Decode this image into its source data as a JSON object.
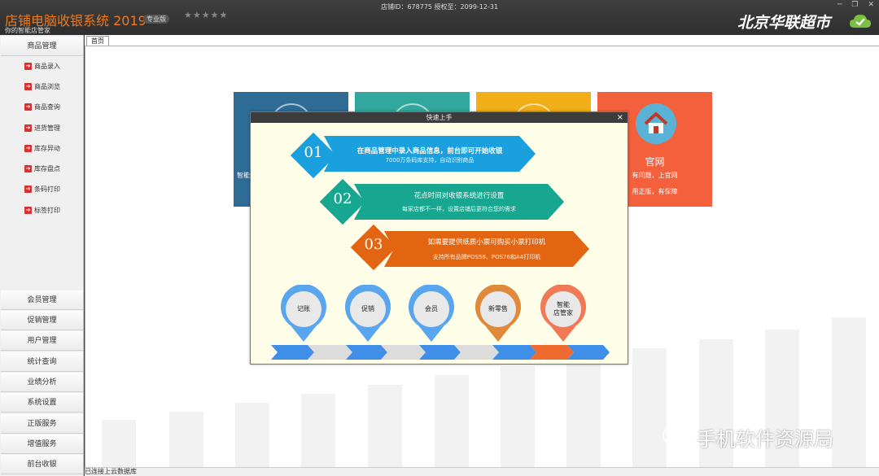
{
  "app": {
    "title": "店铺电脑收银系统 2019",
    "edition": "专业版",
    "stars": "★★★★★",
    "subtitle": "你的智能店管家",
    "store_info": "店铺ID：678775 授权至：2099-12-31",
    "store_name": "北京华联超市",
    "win_min": "─",
    "win_restore": "❐",
    "win_close": "✕"
  },
  "sidebar": {
    "top_item": "商品管理",
    "sub_items": [
      {
        "label": "商品录入",
        "icon": "red-arrow-icon"
      },
      {
        "label": "商品浏览",
        "icon": "red-arrow-icon"
      },
      {
        "label": "商品查询",
        "icon": "red-arrow-icon"
      },
      {
        "label": "进货管理",
        "icon": "red-arrow-icon"
      },
      {
        "label": "库存异动",
        "icon": "red-arrow-icon"
      },
      {
        "label": "库存盘点",
        "icon": "red-arrow-icon"
      },
      {
        "label": "条码打印",
        "icon": "red-arrow-icon"
      },
      {
        "label": "标签打印",
        "icon": "red-arrow-icon"
      }
    ],
    "bottom_items": [
      "会员管理",
      "促销管理",
      "用户管理",
      "统计查询",
      "业绩分析",
      "系统设置",
      "正版服务",
      "增值服务",
      "前台收银"
    ]
  },
  "tabs": {
    "home": "首页"
  },
  "tiles": {
    "left_text": "智能",
    "official": {
      "title": "官网",
      "line1": "有问题，上官网",
      "line2": "用正版，有保障",
      "icon": "house-icon"
    },
    "colors": [
      "#2e6b95",
      "#31a79d",
      "#f1ae17",
      "#f4603c"
    ]
  },
  "dialog": {
    "title": "快速上手",
    "close": "×",
    "steps": [
      {
        "num": "01",
        "line1": "在商品管理中录入商品信息，前台即可开始收银",
        "line2": "7000万条码库支持，自动识别商品",
        "color": "#1aa0df"
      },
      {
        "num": "02",
        "line1": "花点时间对收银系统进行设置",
        "line2": "每家店都不一样，设置店铺后更符合您的需求",
        "color": "#17a68f"
      },
      {
        "num": "03",
        "line1": "如需要提供纸质小票可购买小票打印机",
        "line2": "支持所有品牌POS58、POS76和A4打印机",
        "color": "#e46511"
      }
    ],
    "pins": [
      {
        "label": "记账",
        "color": "#5aa6ee"
      },
      {
        "label": "促销",
        "color": "#5aa6ee"
      },
      {
        "label": "会员",
        "color": "#5aa6ee"
      },
      {
        "label": "新零售",
        "color": "#e0893b"
      },
      {
        "label": "智能\n店管家",
        "color": "#f07a55"
      }
    ]
  },
  "status": "已连接上云数据库",
  "watermark": "手机软件资源局"
}
